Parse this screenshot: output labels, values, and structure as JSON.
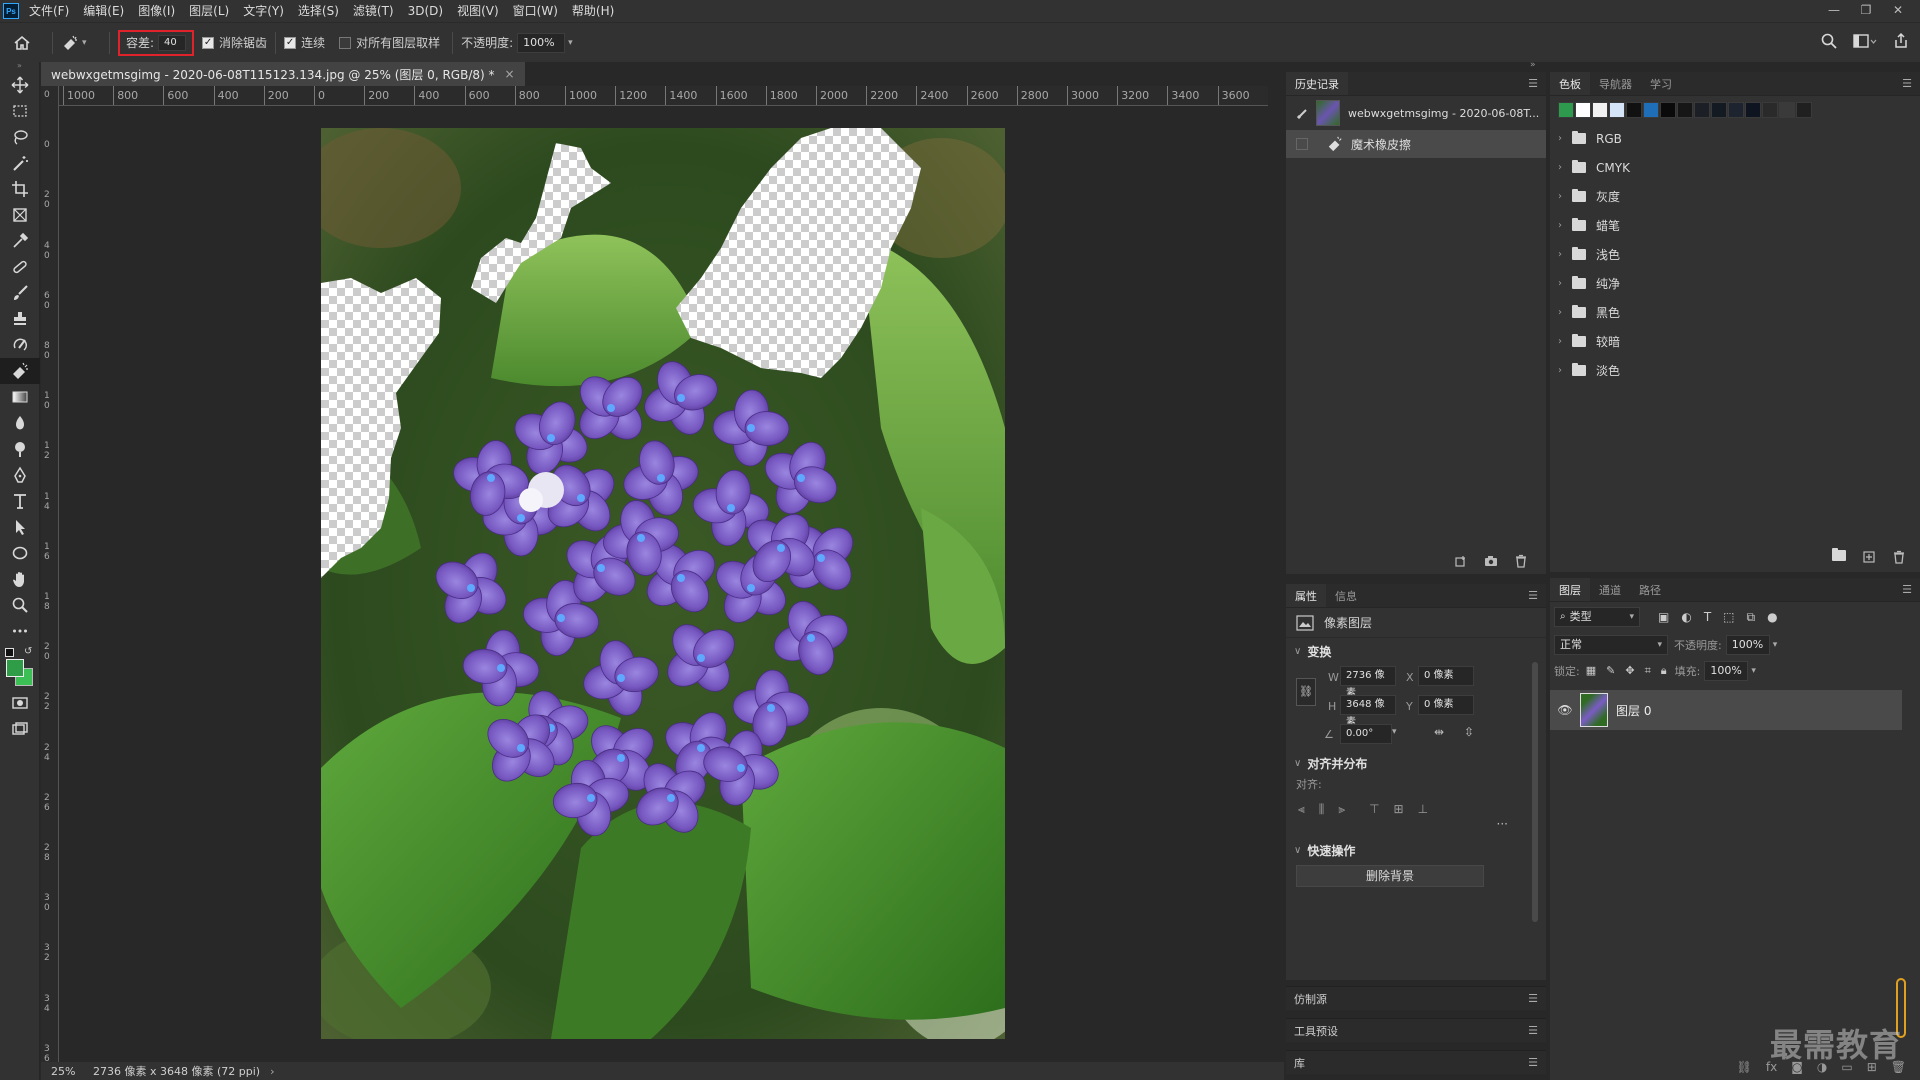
{
  "app": {
    "logo": "Ps"
  },
  "menu": [
    "文件(F)",
    "编辑(E)",
    "图像(I)",
    "图层(L)",
    "文字(Y)",
    "选择(S)",
    "滤镜(T)",
    "3D(D)",
    "视图(V)",
    "窗口(W)",
    "帮助(H)"
  ],
  "window_controls": {
    "minimize": "—",
    "restore": "❐",
    "close": "✕"
  },
  "options": {
    "tolerance_label": "容差:",
    "tolerance_value": "40",
    "antialias_label": "消除锯齿",
    "antialias_checked": true,
    "contiguous_label": "连续",
    "contiguous_checked": true,
    "sample_all_label": "对所有图层取样",
    "sample_all_checked": false,
    "opacity_label": "不透明度:",
    "opacity_value": "100%"
  },
  "document": {
    "tab_title": "webwxgetmsgimg - 2020-06-08T115123.134.jpg @ 25% (图层 0, RGB/8) *",
    "close": "×"
  },
  "ruler": {
    "h_labels": [
      "1000",
      "800",
      "600",
      "400",
      "200",
      "0",
      "200",
      "400",
      "600",
      "800",
      "1000",
      "1200",
      "1400",
      "1600",
      "1800",
      "2000",
      "2200",
      "2400",
      "2600",
      "2800",
      "3000",
      "3200",
      "3400",
      "3600"
    ],
    "v_labels": [
      "0",
      "0",
      "2 0",
      "4 0",
      "6 0",
      "8 0",
      "1 0",
      "1 2",
      "1 4",
      "1 6",
      "1 8",
      "2 0",
      "2 2",
      "2 4",
      "2 6",
      "2 8",
      "3 0",
      "3 2",
      "3 4",
      "3 6"
    ]
  },
  "status": {
    "zoom": "25%",
    "info": "2736 像素 x 3648 像素 (72 ppi)",
    "arrow": "›"
  },
  "history": {
    "tab": "历史记录",
    "snapshot": "webwxgetmsgimg - 2020-06-08T...",
    "step": "魔术橡皮擦"
  },
  "swatches": {
    "tabs": [
      "色板",
      "导航器",
      "学习"
    ],
    "recent_colors": [
      "#2e9a4e",
      "#ffffff",
      "#f2f2f2",
      "#d6e4f7",
      "#111111",
      "#1e6fb8",
      "#0a0a0a",
      "#161616",
      "#1c1f26",
      "#141a22",
      "#1d2430",
      "#0f1520",
      "#2a2a2a",
      "#3a3a3a",
      "#202020"
    ],
    "groups": [
      "RGB",
      "CMYK",
      "灰度",
      "蜡笔",
      "浅色",
      "纯净",
      "黑色",
      "较暗",
      "淡色"
    ]
  },
  "properties": {
    "tabs": [
      "属性",
      "信息"
    ],
    "type": "像素图层",
    "transform_label": "变换",
    "w_label": "W",
    "w_value": "2736 像素",
    "h_label": "H",
    "h_value": "3648 像素",
    "x_label": "X",
    "x_value": "0 像素",
    "y_label": "Y",
    "y_value": "0 像素",
    "angle_value": "0.00°",
    "align_label": "对齐并分布",
    "align_sub": "对齐:",
    "more": "···",
    "quick_label": "快速操作",
    "remove_bg": "删除背景"
  },
  "collapsed_panels": [
    "仿制源",
    "工具预设",
    "库"
  ],
  "layers": {
    "tabs": [
      "图层",
      "通道",
      "路径"
    ],
    "filter_kind": "类型",
    "blend_mode": "正常",
    "opacity_label": "不透明度:",
    "opacity_value": "100%",
    "lock_label": "锁定:",
    "fill_label": "填充:",
    "fill_value": "100%",
    "layer_name": "图层 0"
  },
  "watermark": "最需教育",
  "colors": {
    "foreground": "#2f9c48",
    "background": "#3cbf55",
    "accent_red": "#e0232a"
  }
}
